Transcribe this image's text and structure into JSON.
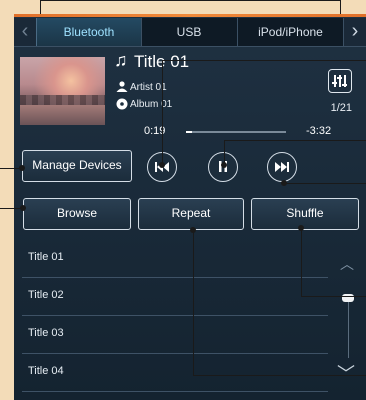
{
  "tabs": {
    "prev_arrow": "‹",
    "next_arrow": "›",
    "items": [
      {
        "label": "Bluetooth",
        "active": true
      },
      {
        "label": "USB",
        "active": false
      },
      {
        "label": "iPod/iPhone",
        "active": false
      }
    ]
  },
  "now_playing": {
    "title": "Title 01",
    "artist": "Artist 01",
    "album": "Album 01",
    "track_count": "1/21",
    "elapsed": "0:19",
    "remaining": "-3:32",
    "progress_fraction": 0.06
  },
  "controls": {
    "manage_devices": "Manage Devices",
    "browse": "Browse",
    "repeat": "Repeat",
    "shuffle": "Shuffle",
    "prev_icon": "skip-back-icon",
    "pause_icon": "pause-icon",
    "next_icon": "skip-forward-icon"
  },
  "track_list": [
    "Title 01",
    "Title 02",
    "Title 03",
    "Title 04"
  ],
  "colors": {
    "accent_tab_text": "#9fe2ff",
    "top_line": "#f08a3a",
    "background_outer": "#f3dcb8"
  }
}
